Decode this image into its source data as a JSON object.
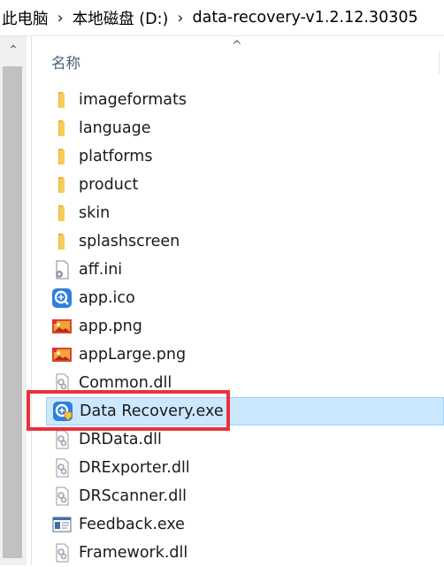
{
  "breadcrumb": [
    "此电脑",
    "本地磁盘 (D:)",
    "data-recovery-v1.2.12.30305"
  ],
  "column_header": {
    "name": "名称"
  },
  "files": [
    {
      "label": "imageformats",
      "icon": "folder-icon"
    },
    {
      "label": "language",
      "icon": "folder-icon"
    },
    {
      "label": "platforms",
      "icon": "folder-icon"
    },
    {
      "label": "product",
      "icon": "folder-icon"
    },
    {
      "label": "skin",
      "icon": "folder-icon"
    },
    {
      "label": "splashscreen",
      "icon": "folder-icon"
    },
    {
      "label": "aff.ini",
      "icon": "settings-file-icon"
    },
    {
      "label": "app.ico",
      "icon": "app-ico-icon"
    },
    {
      "label": "app.png",
      "icon": "image-file-icon"
    },
    {
      "label": "appLarge.png",
      "icon": "image-file-icon"
    },
    {
      "label": "Common.dll",
      "icon": "dll-file-icon"
    },
    {
      "label": "Data Recovery.exe",
      "icon": "app-exe-icon",
      "selected": true
    },
    {
      "label": "DRData.dll",
      "icon": "dll-file-icon"
    },
    {
      "label": "DRExporter.dll",
      "icon": "dll-file-icon"
    },
    {
      "label": "DRScanner.dll",
      "icon": "dll-file-icon"
    },
    {
      "label": "Feedback.exe",
      "icon": "window-exe-icon"
    },
    {
      "label": "Framework.dll",
      "icon": "dll-file-icon"
    }
  ],
  "colors": {
    "selection": "#cce8ff",
    "highlight_box": "#e8323c",
    "folder": "#f3c24a"
  }
}
